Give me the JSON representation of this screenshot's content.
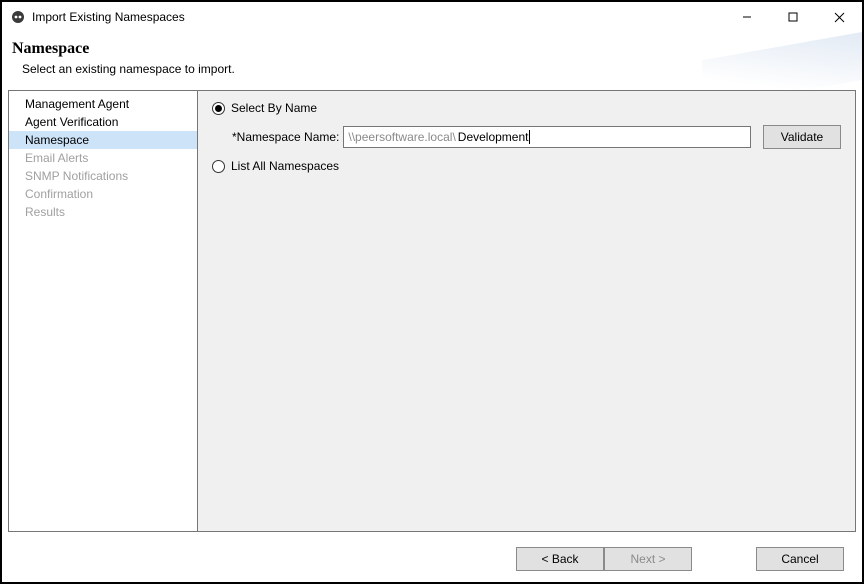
{
  "window": {
    "title": "Import Existing Namespaces",
    "controls": {
      "min": "min",
      "max": "max",
      "close": "close"
    }
  },
  "header": {
    "title": "Namespace",
    "subtitle": "  Select an existing namespace to import."
  },
  "sidebar": {
    "items": [
      {
        "label": "Management Agent",
        "state": "enabled"
      },
      {
        "label": "Agent Verification",
        "state": "enabled"
      },
      {
        "label": "Namespace",
        "state": "selected"
      },
      {
        "label": "Email Alerts",
        "state": "disabled"
      },
      {
        "label": "SNMP Notifications",
        "state": "disabled"
      },
      {
        "label": "Confirmation",
        "state": "disabled"
      },
      {
        "label": "Results",
        "state": "disabled"
      }
    ]
  },
  "main": {
    "select_by_name": {
      "label": "Select By Name",
      "checked": true
    },
    "namespace_field": {
      "label": "*Namespace Name:",
      "prefix": "\\\\peersoftware.local\\",
      "value": "Development"
    },
    "validate_label": "Validate",
    "list_all": {
      "label": "List All Namespaces",
      "checked": false
    }
  },
  "footer": {
    "back": "< Back",
    "next": "Next >",
    "cancel": "Cancel",
    "next_disabled": true
  }
}
